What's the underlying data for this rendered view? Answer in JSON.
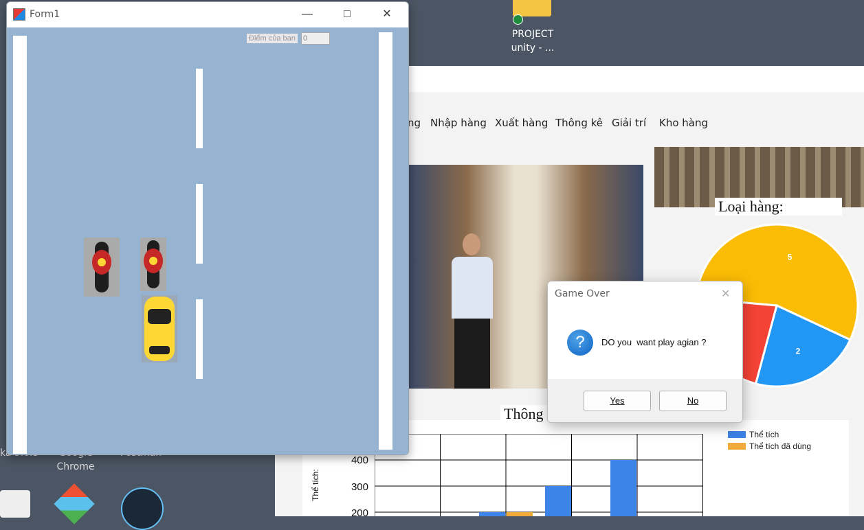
{
  "desktop": {
    "project_label_line1": "PROJECT",
    "project_label_line2": "unity - ...",
    "chrome_line1": "Google",
    "chrome_line2": "Chrome",
    "postman": "Postman",
    "left_partial": "ka 9.0.5"
  },
  "app": {
    "menu": [
      "ng",
      "Nhập hàng",
      "Xuất hàng",
      "Thông kê",
      "Giải trí",
      "Kho hàng"
    ],
    "pie_title": "Loại hàng:",
    "pie": {
      "slices": [
        {
          "value": 5,
          "color": "#fbbc05"
        },
        {
          "value": 2,
          "color": "#2196f3"
        },
        {
          "value": 2,
          "color": "#f44336"
        }
      ]
    },
    "chart_title": "Thông",
    "legend": [
      {
        "label": "Thể tích",
        "color": "#3c84e8"
      },
      {
        "label": "Thể tích đã dùng",
        "color": "#f2a93b"
      }
    ],
    "y_axis_label": "Thể tích:",
    "y_ticks": [
      "400",
      "300",
      "200"
    ]
  },
  "form1": {
    "title": "Form1",
    "score_label": "Điểm của bạn",
    "score_value": "0"
  },
  "dialog": {
    "title": "Game Over",
    "message": "DO you  want play agian ?",
    "yes": "Yes",
    "no": "No"
  },
  "chart_data": {
    "type": "bar",
    "ylabel": "Thể tích:",
    "series": [
      {
        "name": "Thể tích",
        "values": [
          200,
          300,
          400
        ]
      },
      {
        "name": "Thể tích đã dùng",
        "values": [
          200
        ]
      }
    ]
  }
}
